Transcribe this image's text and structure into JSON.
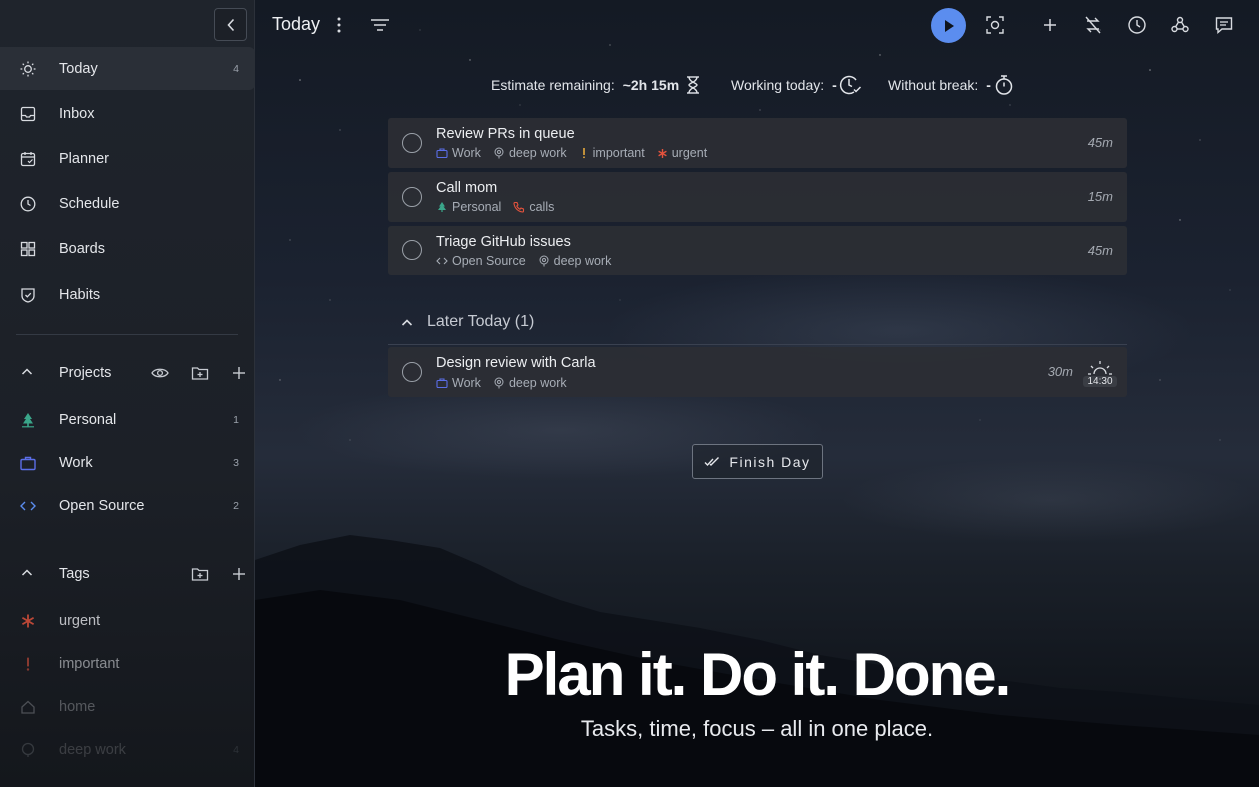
{
  "header": {
    "title": "Today"
  },
  "sidebar": {
    "nav": [
      {
        "label": "Today",
        "count": "4",
        "icon": "sun-icon"
      },
      {
        "label": "Inbox",
        "count": "",
        "icon": "inbox-icon"
      },
      {
        "label": "Planner",
        "count": "",
        "icon": "calendar-icon"
      },
      {
        "label": "Schedule",
        "count": "",
        "icon": "clock-icon"
      },
      {
        "label": "Boards",
        "count": "",
        "icon": "boards-icon"
      },
      {
        "label": "Habits",
        "count": "",
        "icon": "habits-icon"
      }
    ],
    "projects": {
      "label": "Projects",
      "items": [
        {
          "label": "Personal",
          "count": "1",
          "icon": "tree-icon",
          "color": "#3aa68a"
        },
        {
          "label": "Work",
          "count": "3",
          "icon": "briefcase-icon",
          "color": "#5b6ee8"
        },
        {
          "label": "Open Source",
          "count": "2",
          "icon": "code-icon",
          "color": "#5b8def"
        }
      ]
    },
    "tags": {
      "label": "Tags",
      "items": [
        {
          "label": "urgent",
          "count": "",
          "icon": "asterisk-icon",
          "color": "#e5533d"
        },
        {
          "label": "important",
          "count": "",
          "icon": "exclamation-icon",
          "color": "#e5a93d"
        },
        {
          "label": "home",
          "count": "",
          "icon": "home-icon",
          "color": "#8a919b"
        },
        {
          "label": "deep work",
          "count": "4",
          "icon": "brain-icon",
          "color": "#8a919b"
        }
      ]
    }
  },
  "stats": {
    "estimate_label": "Estimate remaining:",
    "estimate_value": "~2h 15m",
    "working_label": "Working today:",
    "working_value": "-",
    "break_label": "Without break:",
    "break_value": "-"
  },
  "tasks": [
    {
      "title": "Review PRs in queue",
      "estimate": "45m",
      "project": "Work",
      "tags": [
        "deep work",
        "important",
        "urgent"
      ]
    },
    {
      "title": "Call mom",
      "estimate": "15m",
      "project": "Personal",
      "tags": [
        "calls"
      ]
    },
    {
      "title": "Triage GitHub issues",
      "estimate": "45m",
      "project": "Open Source",
      "tags": [
        "deep work"
      ]
    }
  ],
  "later": {
    "label": "Later Today (1)",
    "tasks": [
      {
        "title": "Design review with Carla",
        "estimate": "30m",
        "project": "Work",
        "tags": [
          "deep work"
        ],
        "time": "14:30"
      }
    ]
  },
  "finish_button": "Finish Day",
  "hero": {
    "title": "Plan it. Do it. Done.",
    "subtitle": "Tasks, time, focus – all in one place."
  },
  "colors": {
    "accent": "#5b8def",
    "urgent": "#e5533d",
    "important": "#e5a93d",
    "calls": "#e5533d"
  }
}
